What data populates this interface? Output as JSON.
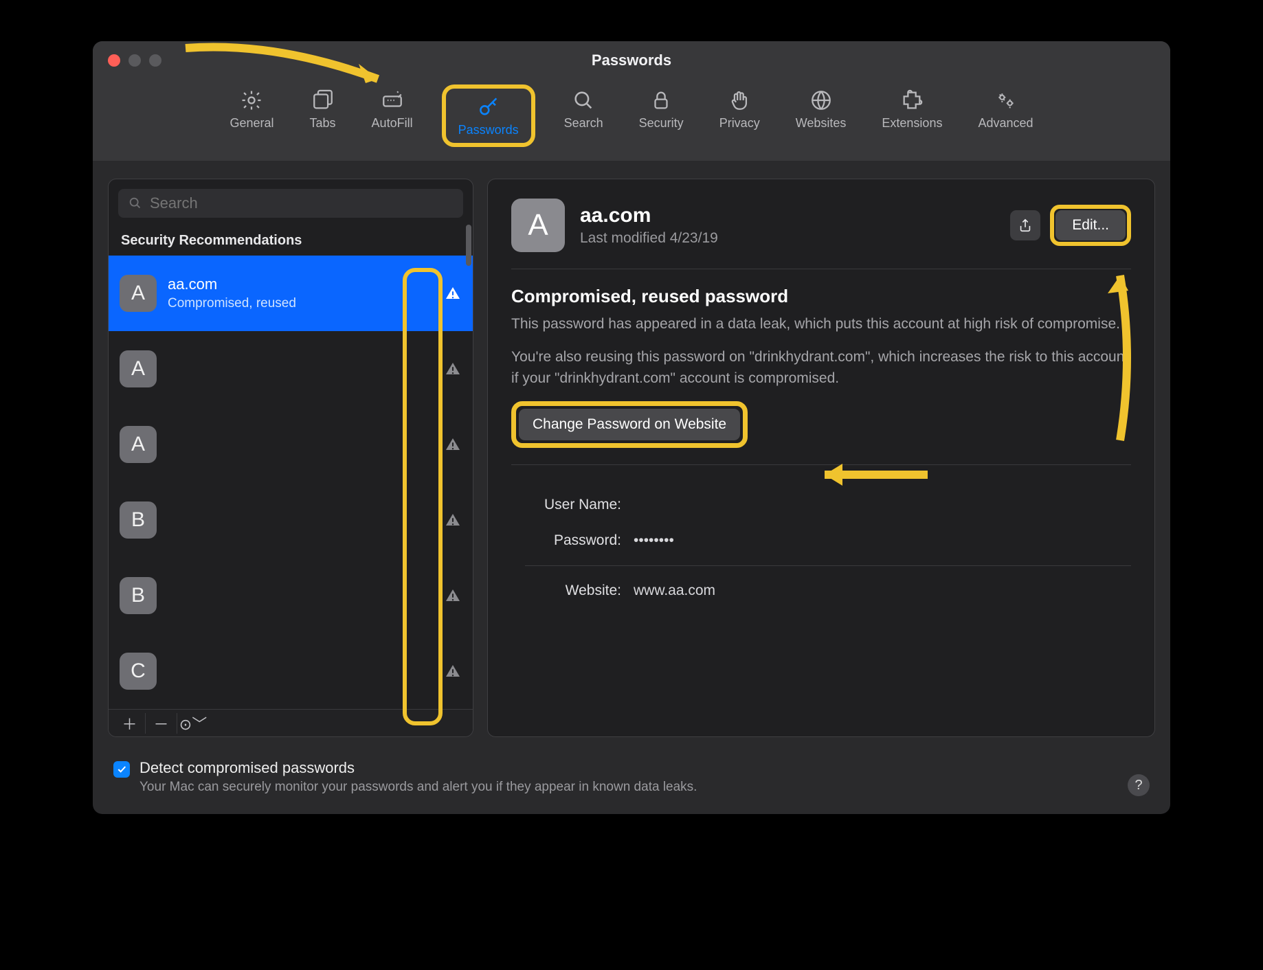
{
  "window": {
    "title": "Passwords"
  },
  "toolbar": {
    "items": [
      {
        "id": "general",
        "label": "General"
      },
      {
        "id": "tabs",
        "label": "Tabs"
      },
      {
        "id": "autofill",
        "label": "AutoFill"
      },
      {
        "id": "passwords",
        "label": "Passwords"
      },
      {
        "id": "search",
        "label": "Search"
      },
      {
        "id": "security",
        "label": "Security"
      },
      {
        "id": "privacy",
        "label": "Privacy"
      },
      {
        "id": "websites",
        "label": "Websites"
      },
      {
        "id": "extensions",
        "label": "Extensions"
      },
      {
        "id": "advanced",
        "label": "Advanced"
      }
    ],
    "active": "passwords"
  },
  "sidebar": {
    "search_placeholder": "Search",
    "section_header": "Security Recommendations",
    "items": [
      {
        "letter": "A",
        "title": "aa.com",
        "subtitle": "Compromised, reused",
        "selected": true
      },
      {
        "letter": "A",
        "title": "",
        "subtitle": ""
      },
      {
        "letter": "A",
        "title": "",
        "subtitle": ""
      },
      {
        "letter": "B",
        "title": "",
        "subtitle": ""
      },
      {
        "letter": "B",
        "title": "",
        "subtitle": ""
      },
      {
        "letter": "C",
        "title": "",
        "subtitle": ""
      }
    ]
  },
  "detail": {
    "avatar_letter": "A",
    "title": "aa.com",
    "subtitle": "Last modified 4/23/19",
    "edit_label": "Edit...",
    "warning_title": "Compromised, reused password",
    "warning_body_1": "This password has appeared in a data leak, which puts this account at high risk of compromise.",
    "warning_body_2": "You're also reusing this password on \"drinkhydrant.com\", which increases the risk to this account if your \"drinkhydrant.com\" account is compromised.",
    "change_label": "Change Password on Website",
    "fields": {
      "username_label": "User Name:",
      "username_value": "",
      "password_label": "Password:",
      "password_value": "••••••••",
      "website_label": "Website:",
      "website_value": "www.aa.com"
    }
  },
  "footer": {
    "checkbox_checked": true,
    "title": "Detect compromised passwords",
    "subtitle": "Your Mac can securely monitor your passwords and alert you if they appear in known data leaks.",
    "help": "?"
  }
}
